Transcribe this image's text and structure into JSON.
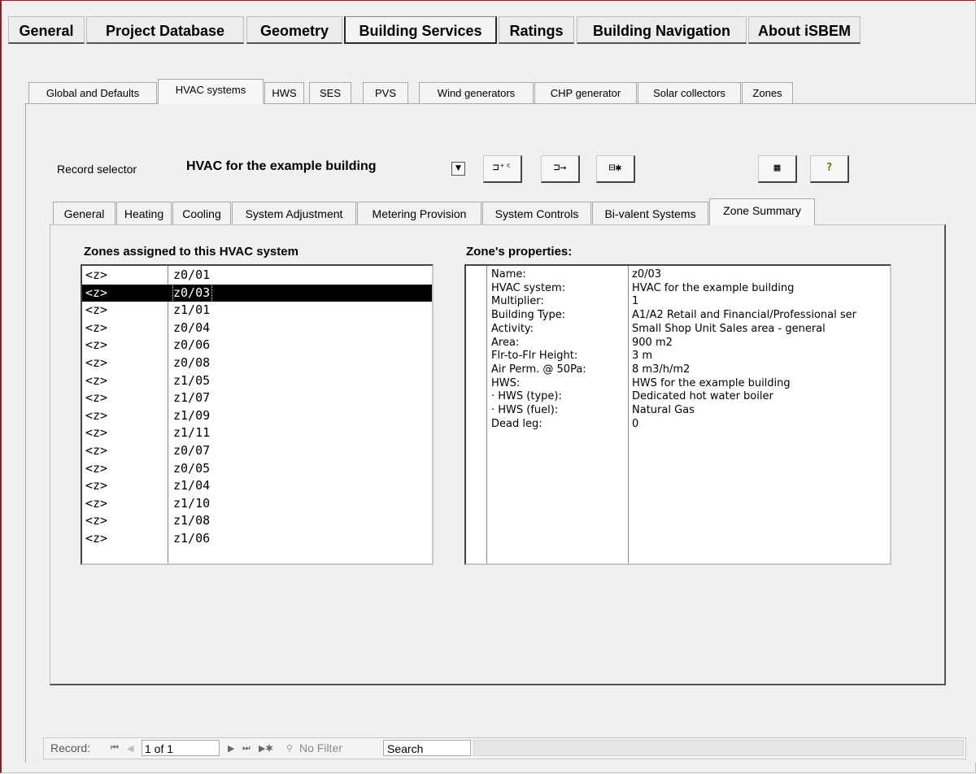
{
  "top_tabs": [
    "General",
    "Project Database",
    "Geometry",
    "Building Services",
    "Ratings",
    "Building Navigation",
    "About iSBEM"
  ],
  "top_tab_active": "Building Services",
  "sub_tabs": [
    "Global and Defaults",
    "HVAC systems",
    "HWS",
    "SES",
    "PVS",
    "Wind generators",
    "CHP generator",
    "Solar collectors",
    "Zones"
  ],
  "sub_tab_active": "HVAC systems",
  "record_selector": {
    "label": "Record selector",
    "value": "HVAC for the example building"
  },
  "toolbar_icons": [
    "add-record-icon",
    "copy-record-icon",
    "delete-record-icon",
    "table-view-icon",
    "help-icon"
  ],
  "inner_tabs": [
    "General",
    "Heating",
    "Cooling",
    "System Adjustment",
    "Metering Provision",
    "System Controls",
    "Bi-valent Systems",
    "Zone Summary"
  ],
  "inner_tab_active": "Zone Summary",
  "zones_list": {
    "title": "Zones assigned to this HVAC system",
    "rows": [
      {
        "type": "<z>",
        "name": "z0/01",
        "selected": false
      },
      {
        "type": "<z>",
        "name": "z0/03",
        "selected": true
      },
      {
        "type": "<z>",
        "name": "z1/01",
        "selected": false
      },
      {
        "type": "<z>",
        "name": "z0/04",
        "selected": false
      },
      {
        "type": "<z>",
        "name": "z0/06",
        "selected": false
      },
      {
        "type": "<z>",
        "name": "z0/08",
        "selected": false
      },
      {
        "type": "<z>",
        "name": "z1/05",
        "selected": false
      },
      {
        "type": "<z>",
        "name": "z1/07",
        "selected": false
      },
      {
        "type": "<z>",
        "name": "z1/09",
        "selected": false
      },
      {
        "type": "<z>",
        "name": "z1/11",
        "selected": false
      },
      {
        "type": "<z>",
        "name": "z0/07",
        "selected": false
      },
      {
        "type": "<z>",
        "name": "z0/05",
        "selected": false
      },
      {
        "type": "<z>",
        "name": "z1/04",
        "selected": false
      },
      {
        "type": "<z>",
        "name": "z1/10",
        "selected": false
      },
      {
        "type": "<z>",
        "name": "z1/08",
        "selected": false
      },
      {
        "type": "<z>",
        "name": "z1/06",
        "selected": false
      }
    ]
  },
  "zone_properties": {
    "title": "Zone's properties:",
    "rows": [
      {
        "key": "Name:",
        "value": "z0/03"
      },
      {
        "key": "HVAC system:",
        "value": "HVAC for the example building"
      },
      {
        "key": "Multiplier:",
        "value": "1"
      },
      {
        "key": "Building Type:",
        "value": "A1/A2 Retail and Financial/Professional ser"
      },
      {
        "key": "Activity:",
        "value": "Small Shop Unit Sales area - general"
      },
      {
        "key": "Area:",
        "value": "900 m2"
      },
      {
        "key": "Flr-to-Flr Height:",
        "value": "3 m"
      },
      {
        "key": "Air Perm. @ 50Pa:",
        "value": "8 m3/h/m2"
      },
      {
        "key": "HWS:",
        "value": "HWS for the example building"
      },
      {
        "key": "· HWS (type):",
        "value": "Dedicated hot water boiler"
      },
      {
        "key": "· HWS (fuel):",
        "value": "Natural Gas"
      },
      {
        "key": "Dead leg:",
        "value": "0"
      }
    ]
  },
  "nav": {
    "record_label": "Record:",
    "current": "1 of 1",
    "filter_label": "No Filter",
    "search_label": "Search"
  }
}
